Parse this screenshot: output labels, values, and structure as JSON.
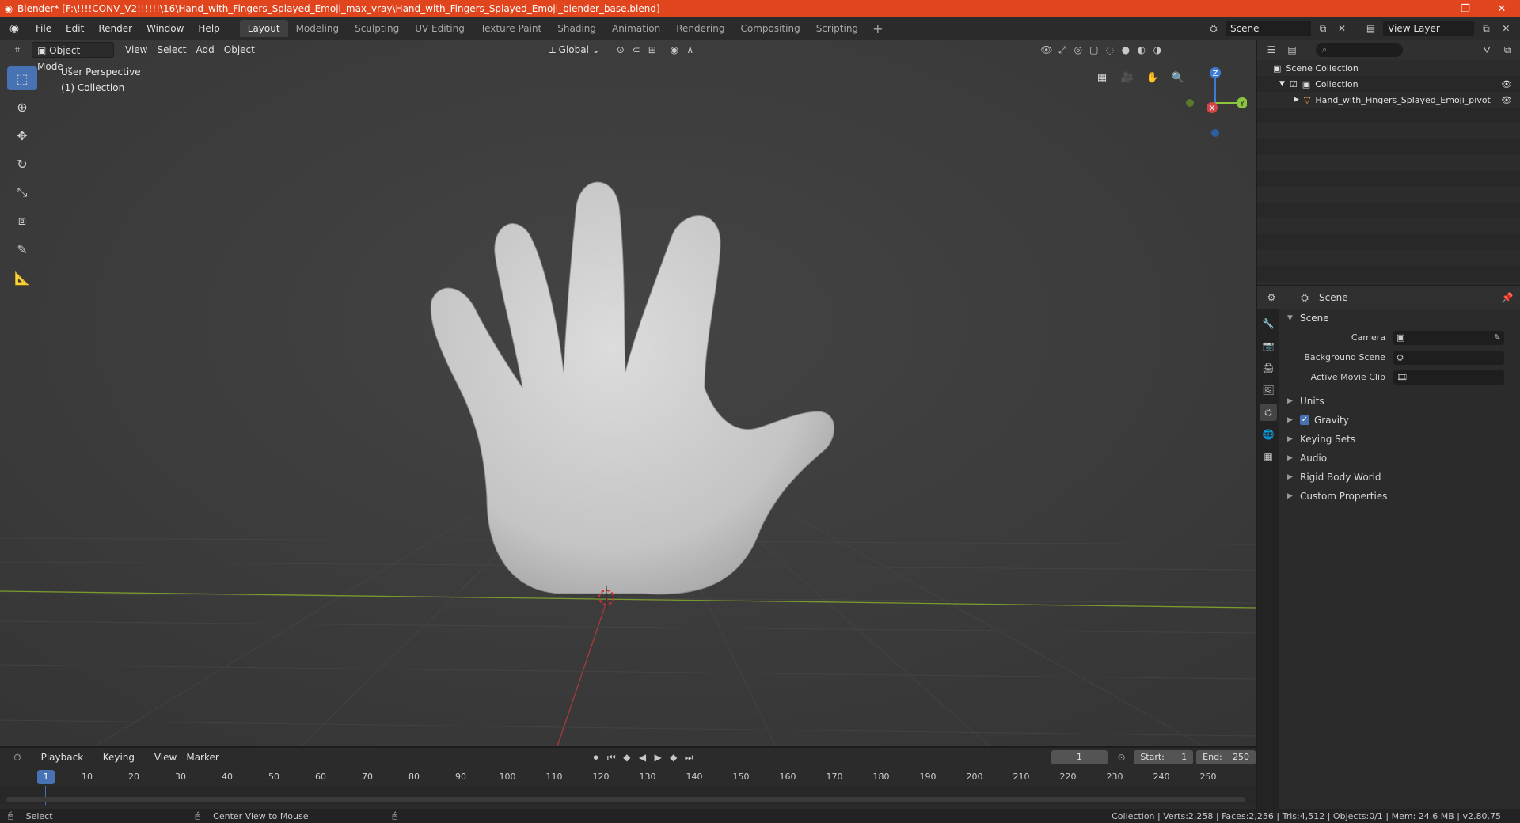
{
  "window": {
    "title": "Blender* [F:\\!!!!CONV_V2!!!!!!\\16\\Hand_with_Fingers_Splayed_Emoji_max_vray\\Hand_with_Fingers_Splayed_Emoji_blender_base.blend]",
    "minimize": "—",
    "restore": "❐",
    "close": "✕"
  },
  "menubar": {
    "items": [
      "File",
      "Edit",
      "Render",
      "Window",
      "Help"
    ],
    "workspaces": [
      "Layout",
      "Modeling",
      "Sculpting",
      "UV Editing",
      "Texture Paint",
      "Shading",
      "Animation",
      "Rendering",
      "Compositing",
      "Scripting"
    ],
    "active_workspace": "Layout",
    "add_workspace": "+",
    "scene_name": "Scene",
    "view_layer": "View Layer"
  },
  "viewport": {
    "mode": "Object Mode",
    "menus": [
      "View",
      "Select",
      "Add",
      "Object"
    ],
    "transform_orientation": "Global",
    "overlay_title": "User Perspective",
    "overlay_subtitle": "(1) Collection",
    "gizmo": {
      "z": "Z",
      "y": "Y",
      "x": "X"
    }
  },
  "outliner": {
    "root": "Scene Collection",
    "collection": "Collection",
    "object": "Hand_with_Fingers_Splayed_Emoji_pivot"
  },
  "properties": {
    "context": "Scene",
    "panel": "Scene",
    "rows": [
      {
        "label": "Camera"
      },
      {
        "label": "Background Scene"
      },
      {
        "label": "Active Movie Clip"
      }
    ],
    "subpanels": [
      "Units",
      "Gravity",
      "Keying Sets",
      "Audio",
      "Rigid Body World",
      "Custom Properties"
    ],
    "gravity_checked": true
  },
  "timeline": {
    "menus": [
      "Playback",
      "Keying",
      "View",
      "Marker"
    ],
    "current_frame": "1",
    "start_label": "Start:",
    "start": "1",
    "end_label": "End:",
    "end": "250",
    "ticks": [
      "10",
      "20",
      "30",
      "40",
      "50",
      "60",
      "70",
      "80",
      "90",
      "100",
      "110",
      "120",
      "130",
      "140",
      "150",
      "160",
      "170",
      "180",
      "190",
      "200",
      "210",
      "220",
      "230",
      "240",
      "250"
    ],
    "ruler_current": "1"
  },
  "statusbar": {
    "left_action": "Select",
    "middle_action": "Center View to Mouse",
    "stats": "Collection | Verts:2,258 | Faces:2,256 | Tris:4,512 | Objects:0/1 | Mem: 24.6 MB | v2.80.75"
  }
}
